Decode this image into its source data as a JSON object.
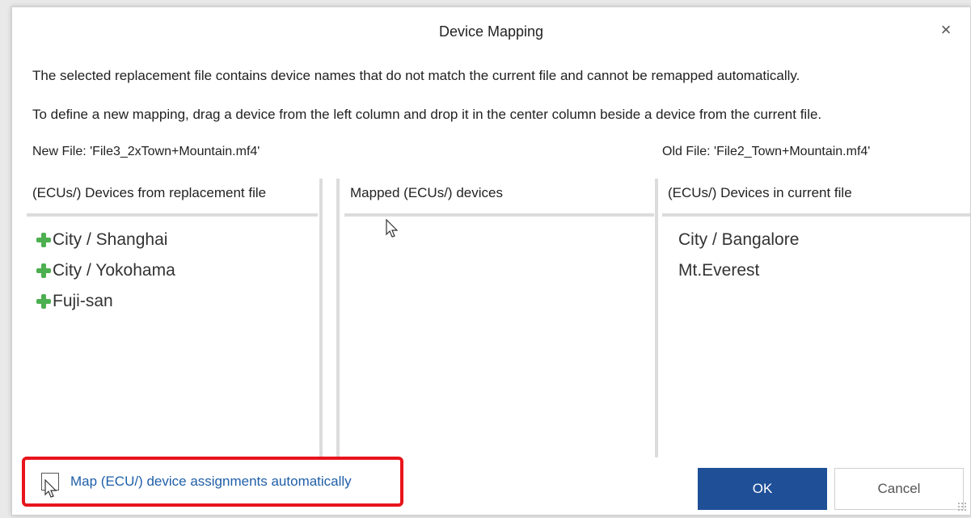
{
  "dialog": {
    "title": "Device Mapping",
    "close_glyph": "×",
    "message1": "The selected replacement file contains device names that do not match the current file and cannot be remapped automatically.",
    "message2": "To define a new mapping, drag a device from the left column and drop it in the center column beside a device from the current file.",
    "new_file_label": "New File: 'File3_2xTown+Mountain.mf4'",
    "old_file_label": "Old File: 'File2_Town+Mountain.mf4'"
  },
  "columns": {
    "left": {
      "header": "(ECUs/) Devices from replacement file",
      "items": [
        {
          "label": "City / Shanghai",
          "icon": "plus-icon"
        },
        {
          "label": "City / Yokohama",
          "icon": "plus-icon"
        },
        {
          "label": "Fuji-san",
          "icon": "plus-icon"
        }
      ]
    },
    "middle": {
      "header": "Mapped (ECUs/) devices",
      "items": []
    },
    "right": {
      "header": "(ECUs/) Devices in current file",
      "items": [
        {
          "label": "City / Bangalore"
        },
        {
          "label": "Mt.Everest"
        }
      ]
    }
  },
  "auto_map": {
    "label": "Map (ECU/) device assignments automatically",
    "checked": false
  },
  "buttons": {
    "ok": "OK",
    "cancel": "Cancel"
  },
  "colors": {
    "primary_button": "#1e4f97",
    "highlight": "#e8141c",
    "link_text": "#1f5fa8",
    "plus_icon": "#4caf50"
  }
}
